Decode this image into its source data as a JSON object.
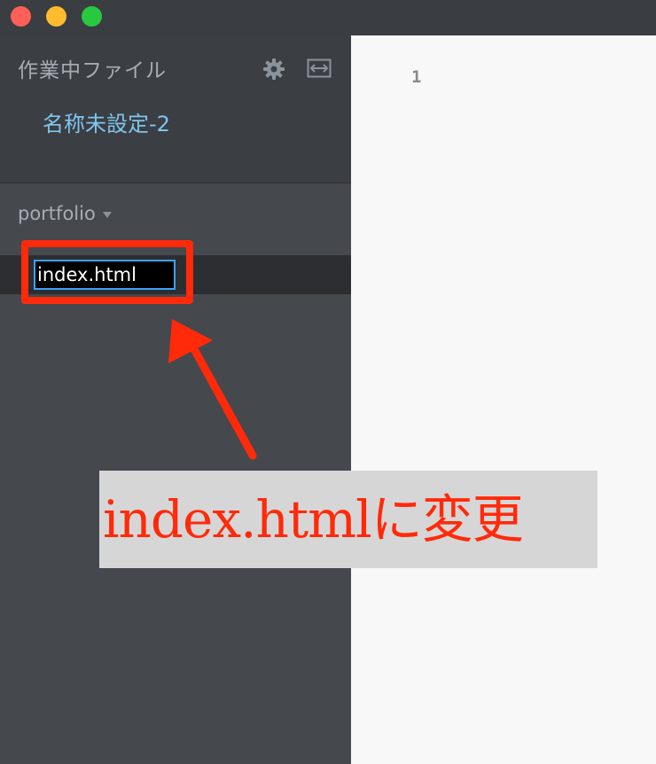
{
  "sidebar": {
    "working_files": {
      "title": "作業中ファイル",
      "file": "名称未設定-2"
    },
    "project": {
      "name": "portfolio",
      "rename_value": "index.html"
    }
  },
  "editor": {
    "line_number": "1"
  },
  "annotation": {
    "text": "index.htmlに変更",
    "color": "#ff2a0a"
  },
  "colors": {
    "sidebar_bg": "#45484d",
    "editor_bg": "#f8f8f8",
    "file_link": "#7ec6ee",
    "input_border": "#3aa3ff"
  },
  "icons": {
    "settings": "gear-icon",
    "split_view": "split-view-icon",
    "project_menu": "caret-down-icon"
  }
}
